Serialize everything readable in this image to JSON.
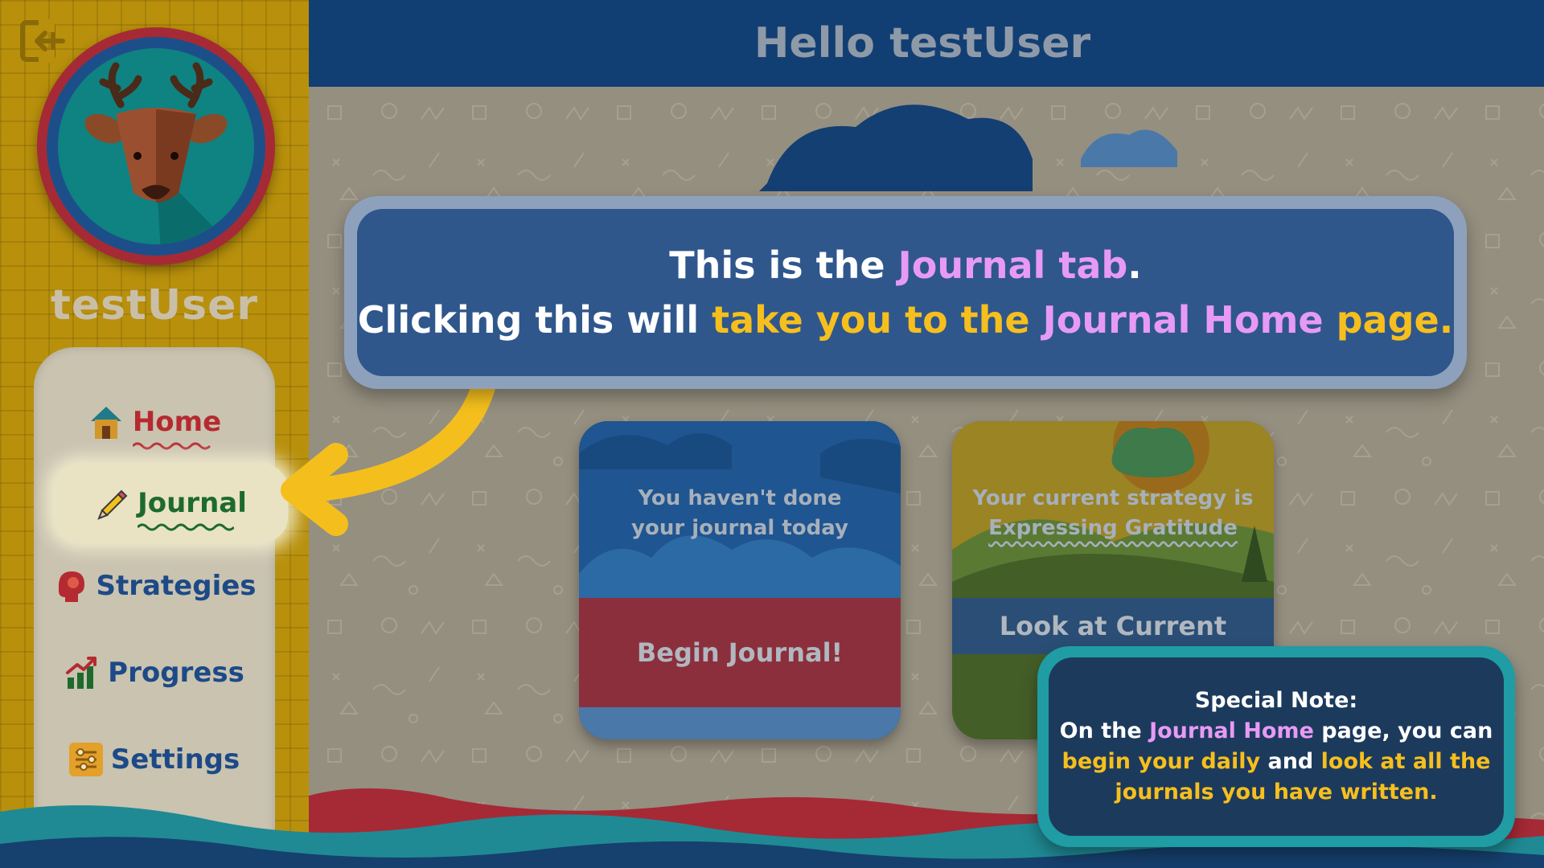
{
  "header": {
    "title": "Hello testUser"
  },
  "sidebar": {
    "username": "testUser",
    "nav_items": [
      {
        "label": "Home",
        "icon": "house-icon"
      },
      {
        "label": "Journal",
        "icon": "pencil-icon"
      },
      {
        "label": "Strategies",
        "icon": "head-icon"
      },
      {
        "label": "Progress",
        "icon": "growth-chart-icon"
      },
      {
        "label": "Settings",
        "icon": "sliders-icon"
      }
    ],
    "avatar_icon": "deer-icon",
    "logout_icon": "logout-icon"
  },
  "cards": {
    "journal": {
      "message": "You haven't done your journal today",
      "button_label": "Begin Journal!"
    },
    "strategy": {
      "message_prefix": "Your current strategy is",
      "strategy_name": "Expressing Gratitude",
      "button_label": "Look at Current"
    }
  },
  "tutorial": {
    "tip_line1_a": "This is the ",
    "tip_line1_b": "Journal tab",
    "tip_line1_c": ".",
    "tip_line2_a": "Clicking this will ",
    "tip_line2_b": "take you to the ",
    "tip_line2_c": "Journal Home",
    "tip_line2_d": " page.",
    "note_title": "Special Note:",
    "note_1a": "On the ",
    "note_1b": "Journal Home",
    "note_1c": " page, you can",
    "note_2a": "begin your daily",
    "note_2b": " and ",
    "note_2c": "look at all the",
    "note_3": "journals you have written."
  },
  "colors": {
    "header_bg": "#123f73",
    "sidebar_bg": "#b8900c",
    "accent_pink": "#e79af5",
    "accent_yellow": "#f6bf1e",
    "tip_bg": "#2f578c",
    "note_border": "#1f9ca4"
  }
}
